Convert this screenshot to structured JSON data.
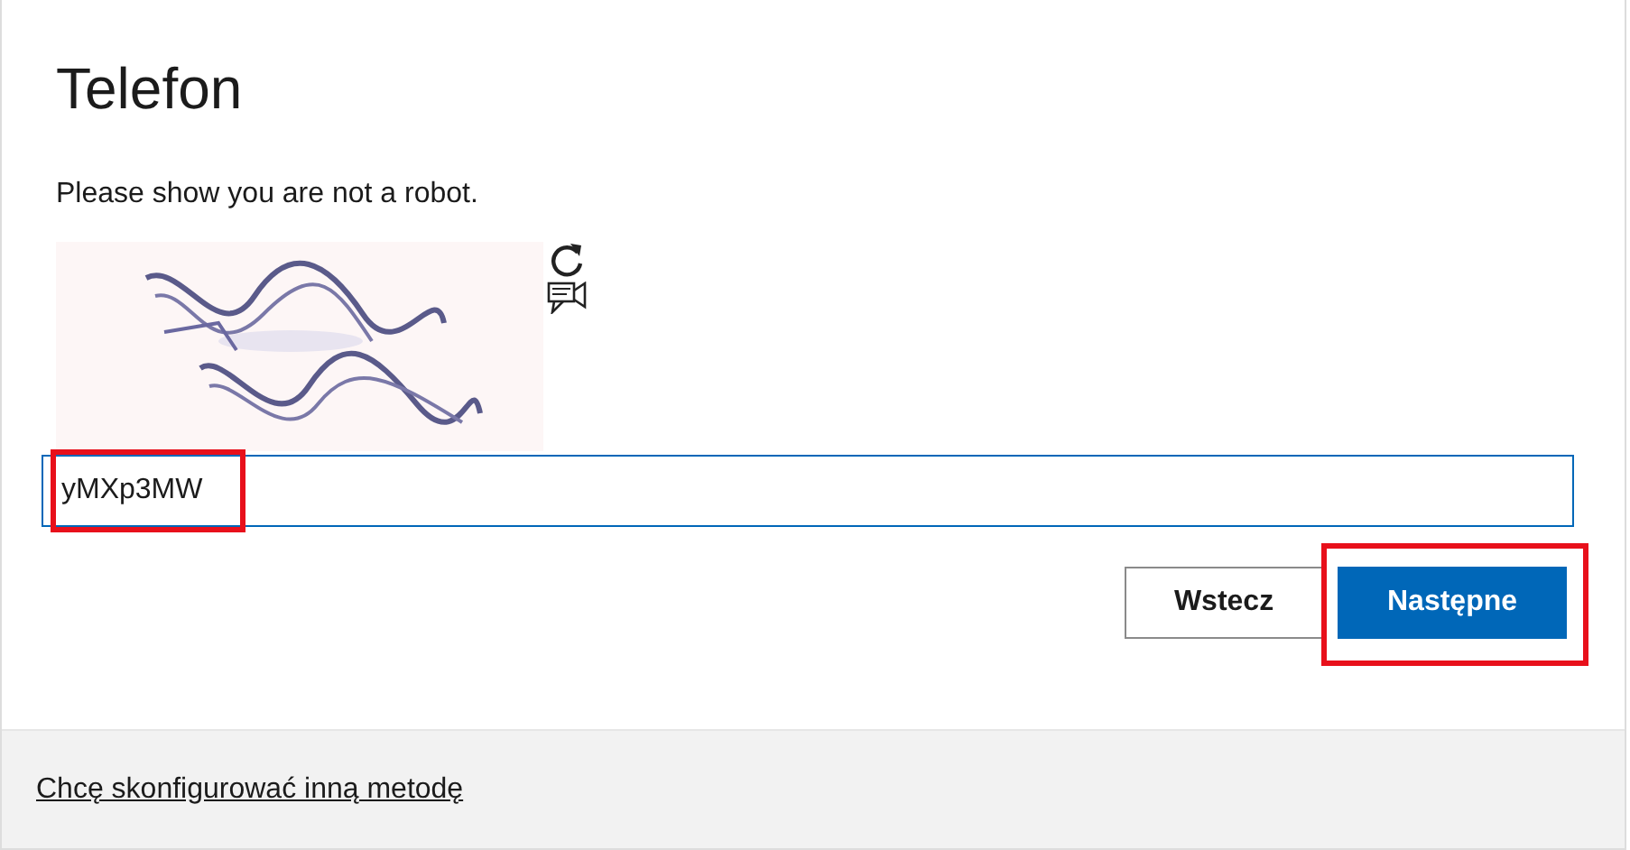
{
  "title": "Telefon",
  "prompt": "Please show you are not a robot.",
  "answer": {
    "value": "yMXp3MW",
    "highlighted": true
  },
  "buttons": [
    {
      "label": "Wstecz",
      "kind": "secondary",
      "highlighted": false
    },
    {
      "label": "Następne",
      "kind": "primary",
      "highlighted": true
    }
  ],
  "footer_link": "Chcę skonfigurować inną metodę"
}
